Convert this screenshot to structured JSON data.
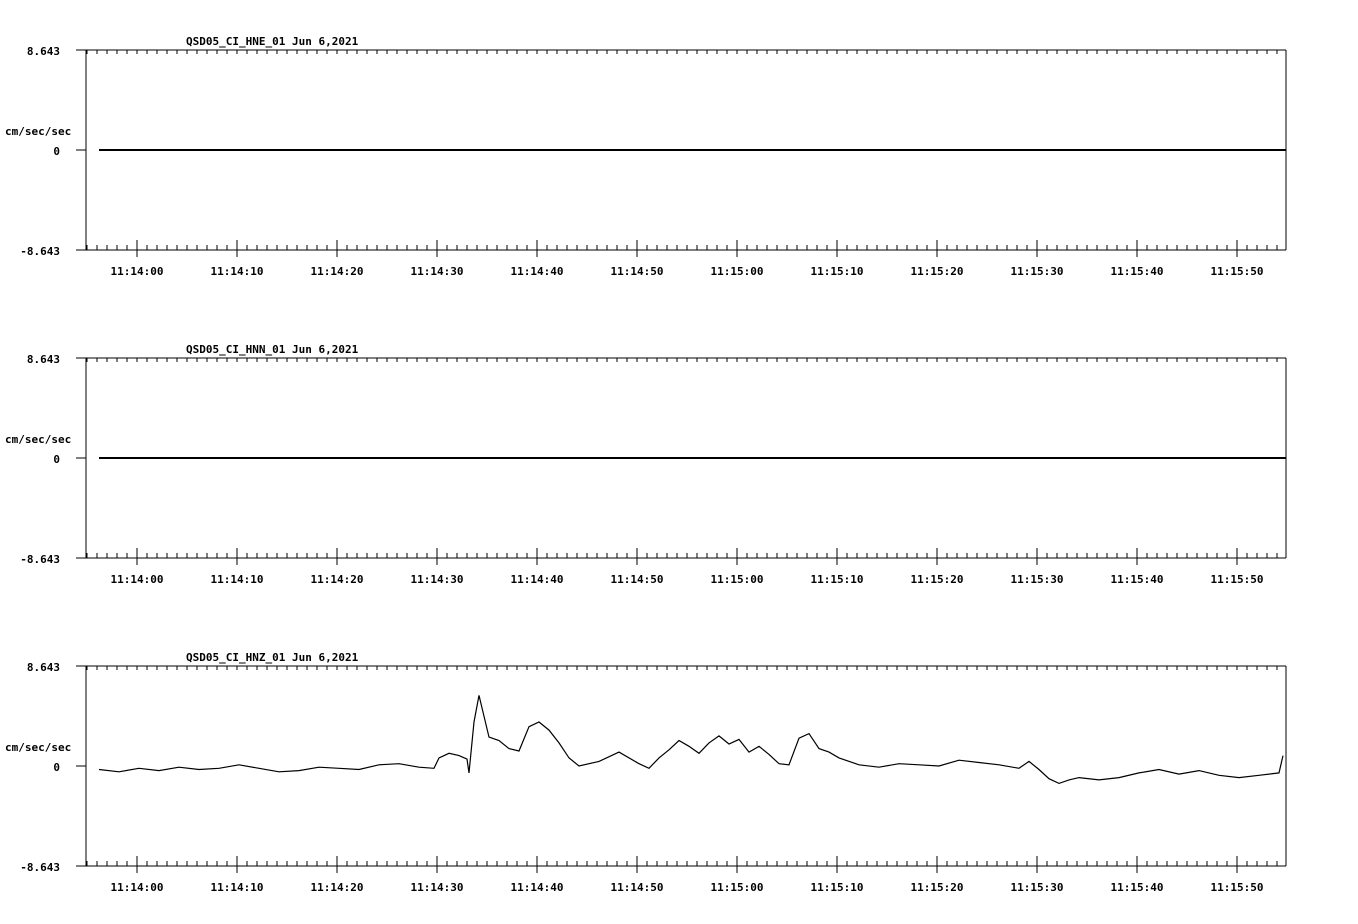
{
  "chart_data": [
    {
      "type": "line",
      "title": "QSD05_CI_HNE_01  Jun 6,2021",
      "ylabel": "cm/sec/sec",
      "ylim": [
        -8.643,
        8.643
      ],
      "y_tick_labels": [
        "8.643",
        "0",
        "-8.643"
      ],
      "x_tick_labels": [
        "11:14:00",
        "11:14:10",
        "11:14:20",
        "11:14:30",
        "11:14:40",
        "11:14:50",
        "11:15:00",
        "11:15:10",
        "11:15:20",
        "11:15:30",
        "11:15:40",
        "11:15:50"
      ],
      "series": [
        {
          "x": [
            0,
            118.4
          ],
          "values": [
            0,
            0
          ]
        }
      ]
    },
    {
      "type": "line",
      "title": "QSD05_CI_HNN_01  Jun 6,2021",
      "ylabel": "cm/sec/sec",
      "ylim": [
        -8.643,
        8.643
      ],
      "y_tick_labels": [
        "8.643",
        "0",
        "-8.643"
      ],
      "x_tick_labels": [
        "11:14:00",
        "11:14:10",
        "11:14:20",
        "11:14:30",
        "11:14:40",
        "11:14:50",
        "11:15:00",
        "11:15:10",
        "11:15:20",
        "11:15:30",
        "11:15:40",
        "11:15:50"
      ],
      "series": [
        {
          "x": [
            0,
            118.4
          ],
          "values": [
            0,
            0
          ]
        }
      ]
    },
    {
      "type": "line",
      "title": "QSD05_CI_HNZ_01  Jun 6,2021",
      "ylabel": "cm/sec/sec",
      "ylim": [
        -8.643,
        8.643
      ],
      "y_tick_labels": [
        "8.643",
        "0",
        "-8.643"
      ],
      "x_tick_labels": [
        "11:14:00",
        "11:14:10",
        "11:14:20",
        "11:14:30",
        "11:14:40",
        "11:14:50",
        "11:15:00",
        "11:15:10",
        "11:15:20",
        "11:15:30",
        "11:15:40",
        "11:15:50"
      ],
      "series": [
        {
          "x": [
            0,
            2,
            4,
            6,
            8,
            10,
            12,
            14,
            16,
            18,
            20,
            22,
            24,
            26,
            28,
            30,
            32,
            33.5,
            34,
            35,
            36,
            36.8,
            37,
            37.5,
            38,
            39,
            40,
            41,
            42,
            43,
            44,
            45,
            46,
            47,
            48,
            50,
            52,
            54,
            55,
            56,
            57,
            58,
            59,
            60,
            61,
            62,
            63,
            64,
            65,
            66,
            67,
            68,
            69,
            70,
            71,
            72,
            73,
            74,
            76,
            78,
            80,
            82,
            84,
            86,
            88,
            90,
            92,
            93,
            94,
            95,
            96,
            97,
            98,
            100,
            102,
            104,
            106,
            108,
            110,
            112,
            114,
            116,
            118,
            118.4
          ],
          "values": [
            -0.3,
            -0.5,
            -0.2,
            -0.4,
            -0.1,
            -0.3,
            -0.2,
            0.1,
            -0.2,
            -0.5,
            -0.4,
            -0.1,
            -0.2,
            -0.3,
            0.1,
            0.2,
            -0.1,
            -0.2,
            0.7,
            1.1,
            0.9,
            0.6,
            -0.6,
            3.8,
            6.1,
            2.5,
            2.2,
            1.5,
            1.3,
            3.4,
            3.8,
            3.1,
            2.0,
            0.7,
            0.0,
            0.4,
            1.2,
            0.2,
            -0.2,
            0.7,
            1.4,
            2.2,
            1.7,
            1.1,
            2.0,
            2.6,
            1.9,
            2.3,
            1.2,
            1.7,
            1.0,
            0.2,
            0.1,
            2.4,
            2.8,
            1.5,
            1.2,
            0.7,
            0.1,
            -0.1,
            0.2,
            0.1,
            0.0,
            0.5,
            0.3,
            0.1,
            -0.2,
            0.4,
            -0.3,
            -1.1,
            -1.5,
            -1.2,
            -1.0,
            -1.2,
            -1.0,
            -0.6,
            -0.3,
            -0.7,
            -0.4,
            -0.8,
            -1.0,
            -0.8,
            -0.6,
            0.9
          ]
        }
      ]
    }
  ]
}
